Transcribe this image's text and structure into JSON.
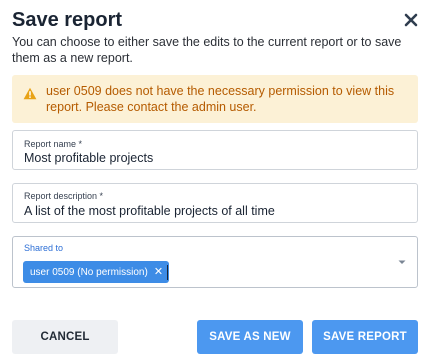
{
  "dialog": {
    "title": "Save report",
    "subtitle": "You can choose to either save the edits to the current report or to save them as a new report."
  },
  "alert": {
    "message": "user 0509 does not have the necessary permission to view this report. Please contact the admin user.",
    "icon": "warning-icon",
    "color": "#b55b00",
    "background": "#fcf1d6"
  },
  "fields": {
    "report_name": {
      "label": "Report name *",
      "value": "Most profitable projects"
    },
    "report_description": {
      "label": "Report description *",
      "value": "A list of the most profitable projects of all time"
    },
    "shared_to": {
      "label": "Shared to",
      "chips": [
        {
          "label": "user 0509 (No permission)"
        }
      ]
    }
  },
  "buttons": {
    "cancel": "CANCEL",
    "save_as_new": "SAVE AS NEW",
    "save_report": "SAVE REPORT"
  },
  "colors": {
    "primary": "#4c98f0",
    "chip": "#3d8ce6",
    "focus_label": "#2d6fd6"
  }
}
